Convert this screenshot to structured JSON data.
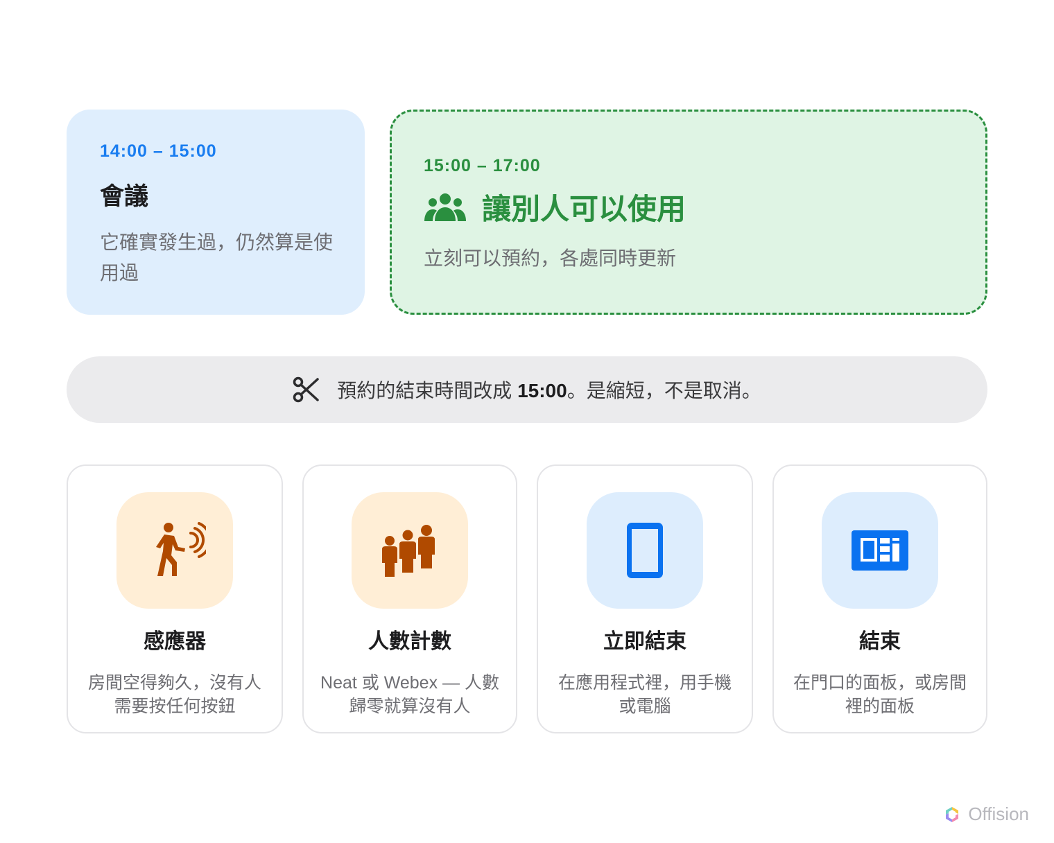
{
  "meeting": {
    "time": "14:00 – 15:00",
    "title": "會議",
    "description": "它確實發生過，仍然算是使用過"
  },
  "freed": {
    "time": "15:00 – 17:00",
    "title": "讓別人可以使用",
    "description": "立刻可以預約，各處同時更新",
    "icon": "people-group-icon",
    "accent": "#2a8f3f"
  },
  "note": {
    "icon": "scissors-icon",
    "prefix": "預約的結束時間改成 ",
    "emphasis": "15:00",
    "suffix": "。是縮短，不是取消。"
  },
  "features": [
    {
      "icon": "motion-sensor-icon",
      "title": "感應器",
      "description": "房間空得夠久，沒有人需要按任何按鈕"
    },
    {
      "icon": "people-count-icon",
      "title": "人數計數",
      "description": "Neat 或 Webex — 人數歸零就算沒有人"
    },
    {
      "icon": "phone-icon",
      "title": "立即結束",
      "description": "在應用程式裡，用手機或電腦"
    },
    {
      "icon": "panel-icon",
      "title": "結束",
      "description": "在門口的面板，或房間裡的面板"
    }
  ],
  "brand": {
    "name": "Offision"
  },
  "colors": {
    "blue": "#1a7df0",
    "green": "#2a8f3f",
    "orange": "#b04a00"
  }
}
